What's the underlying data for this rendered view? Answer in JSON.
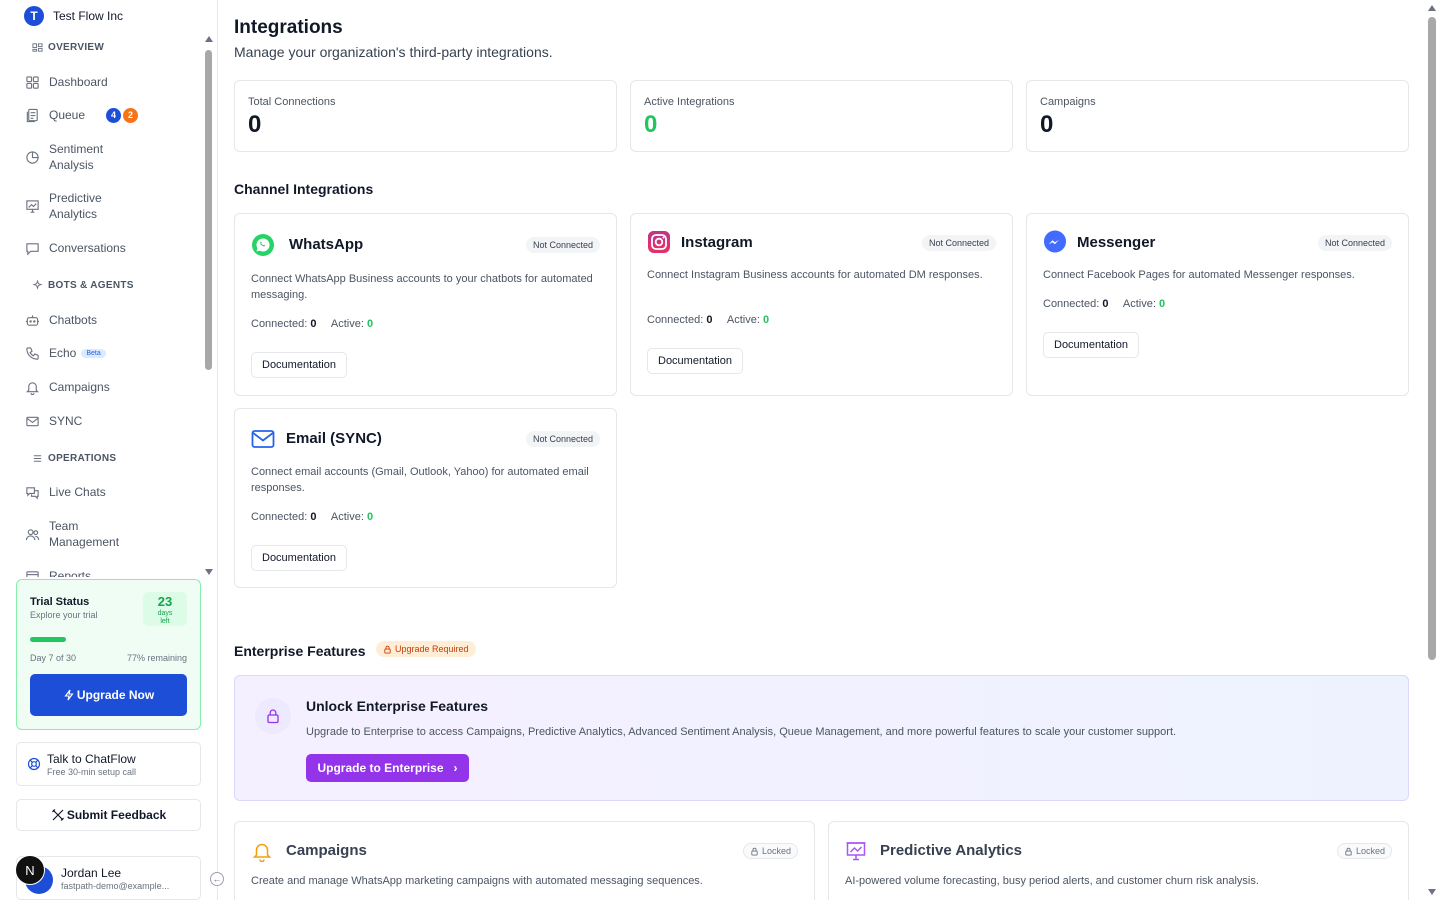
{
  "org": {
    "logo_letter": "T",
    "name": "Test Flow Inc"
  },
  "sidebar": {
    "sections": {
      "overview": "OVERVIEW",
      "bots": "BOTS & AGENTS",
      "operations": "OPERATIONS"
    },
    "items": {
      "dashboard": "Dashboard",
      "queue": "Queue",
      "queue_badge_blue": "4",
      "queue_badge_orange": "2",
      "sentiment": "Sentiment Analysis",
      "predictive": "Predictive Analytics",
      "conversations": "Conversations",
      "chatbots": "Chatbots",
      "echo": "Echo",
      "echo_badge": "Beta",
      "campaigns": "Campaigns",
      "sync": "SYNC",
      "live_chats": "Live Chats",
      "team": "Team Management",
      "reports": "Reports"
    },
    "trial": {
      "title": "Trial Status",
      "subtitle": "Explore your trial",
      "days_number": "23",
      "days_label_1": "days",
      "days_label_2": "left",
      "progress_fraction": 0.23,
      "day_text": "Day 7 of 30",
      "remaining_text": "77% remaining",
      "upgrade_label": "Upgrade Now"
    },
    "talk": {
      "title": "Talk to ChatFlow",
      "subtitle": "Free 30-min setup call"
    },
    "feedback_label": "Submit Feedback",
    "user": {
      "avatar_letter": "N",
      "name": "Jordan Lee",
      "email": "fastpath-demo@example..."
    }
  },
  "page": {
    "title": "Integrations",
    "subtitle": "Manage your organization's third-party integrations."
  },
  "stats": [
    {
      "label": "Total Connections",
      "value": "0"
    },
    {
      "label": "Active Integrations",
      "value": "0"
    },
    {
      "label": "Campaigns",
      "value": "0"
    }
  ],
  "channel_heading": "Channel Integrations",
  "channels": {
    "whatsapp": {
      "name": "WhatsApp",
      "status": "Not Connected",
      "desc": "Connect WhatsApp Business accounts to your chatbots for automated messaging.",
      "connected_label": "Connected:",
      "connected": "0",
      "active_label": "Active:",
      "active": "0",
      "doc_label": "Documentation"
    },
    "instagram": {
      "name": "Instagram",
      "status": "Not Connected",
      "desc": "Connect Instagram Business accounts for automated DM responses.",
      "connected_label": "Connected:",
      "connected": "0",
      "active_label": "Active:",
      "active": "0",
      "doc_label": "Documentation"
    },
    "messenger": {
      "name": "Messenger",
      "status": "Not Connected",
      "desc": "Connect Facebook Pages for automated Messenger responses.",
      "connected_label": "Connected:",
      "connected": "0",
      "active_label": "Active:",
      "active": "0",
      "doc_label": "Documentation"
    },
    "email": {
      "name": "Email (SYNC)",
      "status": "Not Connected",
      "desc": "Connect email accounts (Gmail, Outlook, Yahoo) for automated email responses.",
      "connected_label": "Connected:",
      "connected": "0",
      "active_label": "Active:",
      "active": "0",
      "doc_label": "Documentation"
    }
  },
  "enterprise": {
    "heading": "Enterprise Features",
    "badge": "Upgrade Required",
    "title": "Unlock Enterprise Features",
    "desc": "Upgrade to Enterprise to access Campaigns, Predictive Analytics, Advanced Sentiment Analysis, Queue Management, and more powerful features to scale your customer support.",
    "button": "Upgrade to Enterprise"
  },
  "locked": {
    "campaigns": {
      "title": "Campaigns",
      "badge": "Locked",
      "desc": "Create and manage WhatsApp marketing campaigns with automated messaging sequences."
    },
    "predictive": {
      "title": "Predictive Analytics",
      "badge": "Locked",
      "desc": "AI-powered volume forecasting, busy period alerts, and customer churn risk analysis."
    }
  },
  "colors": {
    "primary": "#1d4ed8",
    "success": "#22c55e",
    "purple": "#9333ea",
    "queue_badge_blue": "#1d4ed8",
    "queue_badge_orange": "#f97316"
  }
}
